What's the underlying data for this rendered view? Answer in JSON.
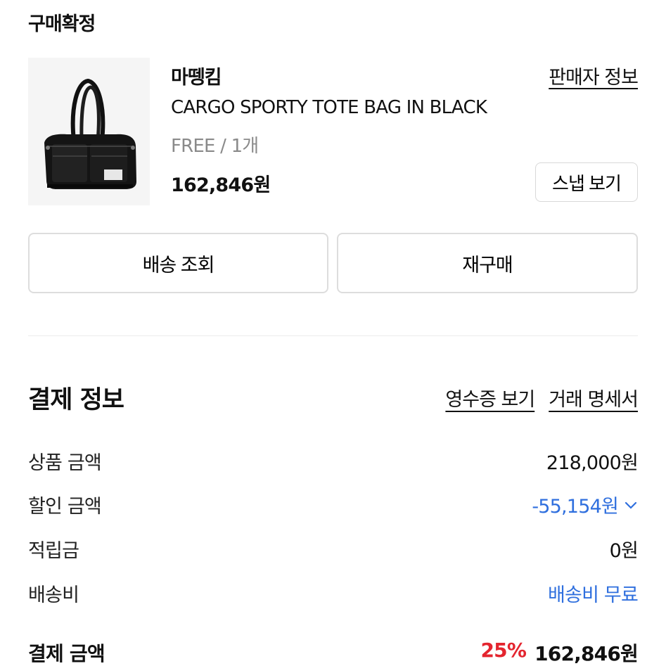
{
  "status": "구매확정",
  "product": {
    "brand": "마뗑킴",
    "seller_link": "판매자 정보",
    "name": "CARGO SPORTY TOTE BAG IN BLACK",
    "option": "FREE / 1개",
    "price": "162,846원",
    "snap_button": "스냅 보기",
    "image_icon": "black-tote-bag-image"
  },
  "actions": {
    "delivery_button": "배송 조회",
    "reorder_button": "재구매"
  },
  "payment": {
    "title": "결제 정보",
    "receipt_link": "영수증 보기",
    "statement_link": "거래 명세서",
    "rows": [
      {
        "label": "상품 금액",
        "value": "218,000원"
      },
      {
        "label": "할인 금액",
        "value": "-55,154원"
      },
      {
        "label": "적립금",
        "value": "0원"
      },
      {
        "label": "배송비",
        "value": "배송비 무료"
      }
    ],
    "total": {
      "label": "결제 금액",
      "percent": "25%",
      "value": "162,846원"
    }
  },
  "colors": {
    "accent_blue": "#2f6fde",
    "discount_red": "#e4252f",
    "border": "#dddddd"
  }
}
